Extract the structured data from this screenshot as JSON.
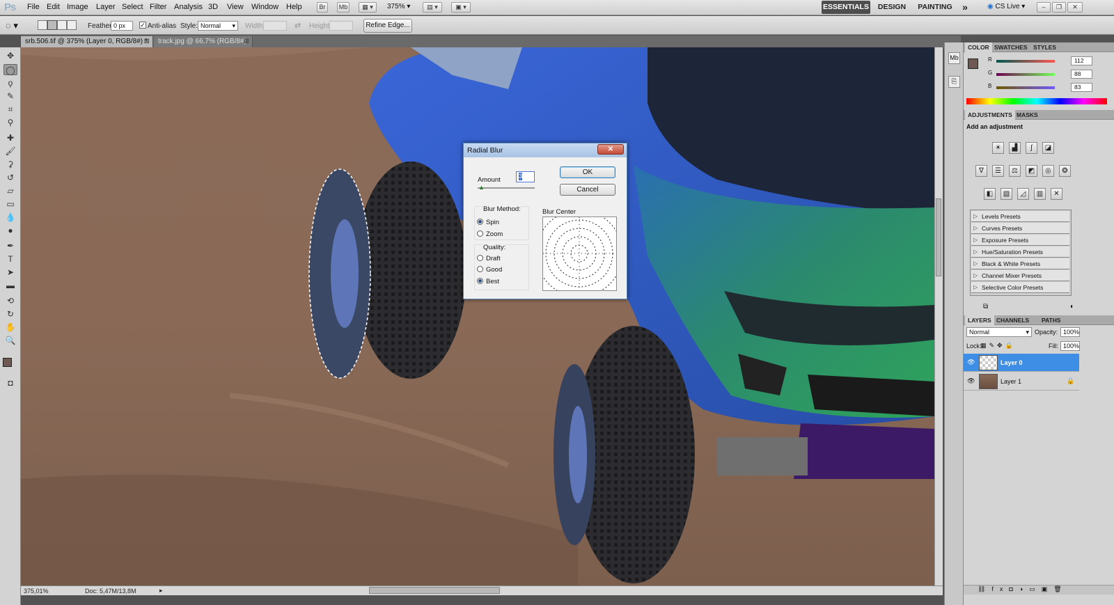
{
  "app": {
    "logo": "Ps"
  },
  "menu": [
    "File",
    "Edit",
    "Image",
    "Layer",
    "Select",
    "Filter",
    "Analysis",
    "3D",
    "View",
    "Window",
    "Help"
  ],
  "appbar": {
    "bridge": "Br",
    "minibridge": "Mb",
    "zoom": "375%"
  },
  "workspace": {
    "tabs": [
      "ESSENTIALS",
      "DESIGN",
      "PAINTING"
    ],
    "active": "ESSENTIALS",
    "more": "»",
    "cslive": "CS Live"
  },
  "options": {
    "feather_label": "Feather:",
    "feather_value": "0 px",
    "antialias_label": "Anti-alias",
    "antialias_checked": true,
    "style_label": "Style:",
    "style_value": "Normal",
    "width_label": "Width:",
    "height_label": "Height:",
    "refine_edge": "Refine Edge..."
  },
  "doc_tabs": [
    {
      "label": "srb.506.tif @ 375% (Layer 0, RGB/8#) *",
      "active": true
    },
    {
      "label": "track.jpg @ 66,7% (RGB/8#)",
      "active": false
    }
  ],
  "tools": [
    "move-tool",
    "elliptical-marquee-tool",
    "lasso-tool",
    "quick-selection-tool",
    "crop-tool",
    "eyedropper-tool",
    "spot-healing-tool",
    "brush-tool",
    "clone-stamp-tool",
    "history-brush-tool",
    "eraser-tool",
    "gradient-tool",
    "blur-tool",
    "dodge-tool",
    "pen-tool",
    "type-tool",
    "path-selection-tool",
    "rectangle-tool",
    "3d-rotate-tool",
    "3d-orbit-tool",
    "hand-tool",
    "zoom-tool"
  ],
  "status": {
    "zoom": "375,01%",
    "doc": "Doc: 5,47M/13,8M"
  },
  "color_panel": {
    "tabs": [
      "COLOR",
      "SWATCHES",
      "STYLES"
    ],
    "r_label": "R",
    "r": 112,
    "g_label": "G",
    "g": 88,
    "b_label": "B",
    "b": 83,
    "foreground": "#705853"
  },
  "adjustments_panel": {
    "tabs": [
      "ADJUSTMENTS",
      "MASKS"
    ],
    "heading": "Add an adjustment",
    "presets": [
      "Levels Presets",
      "Curves Presets",
      "Exposure Presets",
      "Hue/Saturation Presets",
      "Black & White Presets",
      "Channel Mixer Presets",
      "Selective Color Presets"
    ]
  },
  "layers_panel": {
    "tabs": [
      "LAYERS",
      "CHANNELS",
      "PATHS"
    ],
    "blend_mode": "Normal",
    "opacity_label": "Opacity:",
    "opacity": "100%",
    "lock_label": "Lock:",
    "fill_label": "Fill:",
    "fill": "100%",
    "layers": [
      {
        "name": "Layer 0",
        "active": true
      },
      {
        "name": "Layer 1",
        "active": false
      }
    ]
  },
  "dialog": {
    "title": "Radial Blur",
    "close": "✕",
    "amount_label": "Amount",
    "amount_value": "3",
    "ok": "OK",
    "cancel": "Cancel",
    "blur_method_label": "Blur Method:",
    "blur_methods": [
      "Spin",
      "Zoom"
    ],
    "blur_method_selected": "Spin",
    "quality_label": "Quality:",
    "qualities": [
      "Draft",
      "Good",
      "Best"
    ],
    "quality_selected": "Best",
    "blur_center_label": "Blur Center"
  }
}
